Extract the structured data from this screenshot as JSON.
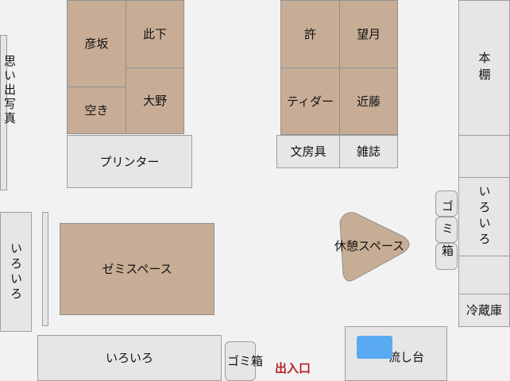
{
  "desks": {
    "hikosaka": "彦坂",
    "hishita": "此下",
    "aki": "空き",
    "ono": "大野",
    "kyo": "許",
    "mochizuki": "望月",
    "tidar": "ティダー",
    "kondo": "近藤"
  },
  "areas": {
    "omoide_shashin": "思い出写真",
    "printer": "プリンター",
    "bunbougu": "文房具",
    "zasshi": "雑誌",
    "hondana": "本棚",
    "iroiro_right": "いろいろ",
    "iroiro_left": "いろいろ",
    "iroiro_bottom": "いろいろ",
    "zemi_space": "ゼミスペース",
    "kyukei_space": "休憩スペース",
    "gomibako_right": "ゴミ箱",
    "gomibako_bottom": "ゴミ箱",
    "reizouko": "冷蔵庫",
    "nagashidai": "流し台",
    "exit": "出入口"
  },
  "colors": {
    "desk": "#c8ad96",
    "furniture": "#e6e6e6",
    "sink": "#5aaaf2",
    "exit_text": "#b5232a"
  }
}
